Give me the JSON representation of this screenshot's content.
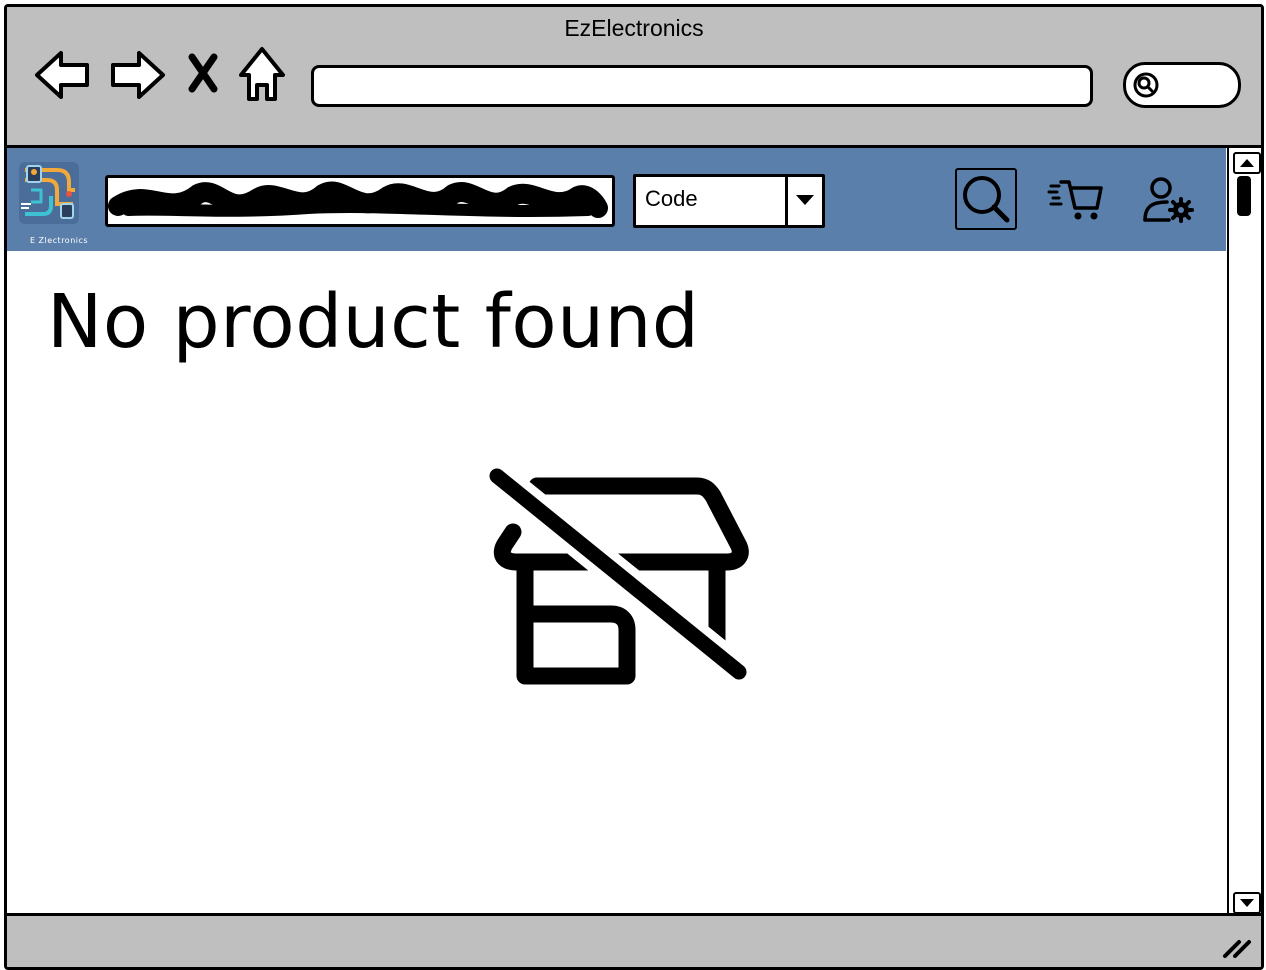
{
  "window": {
    "title": "EzElectronics"
  },
  "browser": {
    "back_icon": "back-arrow-icon",
    "forward_icon": "forward-arrow-icon",
    "stop_icon": "close-icon",
    "home_icon": "home-icon",
    "address_value": "",
    "search_icon": "search-icon"
  },
  "header": {
    "background": "#5b7fab",
    "logo_caption": "E Zlectronics",
    "search_input_value": "",
    "search_type_selected": "Code",
    "search_button_icon": "search-icon",
    "cart_icon": "cart-icon",
    "account_icon": "user-settings-icon"
  },
  "main": {
    "empty_title": "No product found",
    "empty_icon": "store-off-icon"
  }
}
